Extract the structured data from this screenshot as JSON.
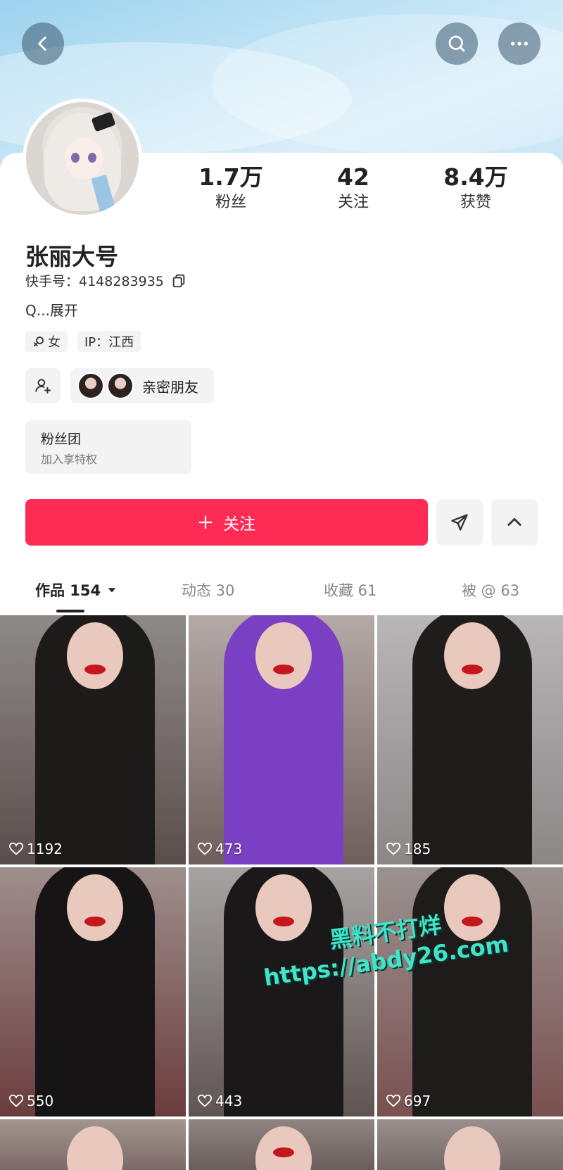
{
  "header": {
    "back_icon": "chevron-left-icon",
    "search_icon": "search-icon",
    "more_icon": "more-horizontal-icon"
  },
  "profile": {
    "stats": [
      {
        "value": "1.7万",
        "label": "粉丝"
      },
      {
        "value": "42",
        "label": "关注"
      },
      {
        "value": "8.4万",
        "label": "获赞"
      }
    ],
    "name": "张丽大号",
    "kuaishou_id_label": "快手号：4148283935",
    "bio": "Q...展开",
    "tags": {
      "gender": "女",
      "ip": "IP：江西"
    },
    "close_friends": "亲密朋友",
    "fan_group": {
      "title": "粉丝团",
      "subtitle": "加入享特权"
    }
  },
  "actions": {
    "follow_label": "关注",
    "follow_icon": "plus-icon",
    "share_icon": "send-icon",
    "collapse_icon": "chevron-up-icon",
    "accent": "#fe2c55"
  },
  "tabs": [
    {
      "label": "作品 154",
      "active": true
    },
    {
      "label": "动态 30",
      "active": false
    },
    {
      "label": "收藏 61",
      "active": false
    },
    {
      "label": "被 @ 63",
      "active": false
    }
  ],
  "posts": [
    {
      "likes": "1192"
    },
    {
      "likes": "473"
    },
    {
      "likes": "185"
    },
    {
      "likes": "550"
    },
    {
      "likes": "443"
    },
    {
      "likes": "697"
    }
  ],
  "watermark": {
    "line1": "黑料不打烊",
    "line2": "https://abdy26.com"
  }
}
